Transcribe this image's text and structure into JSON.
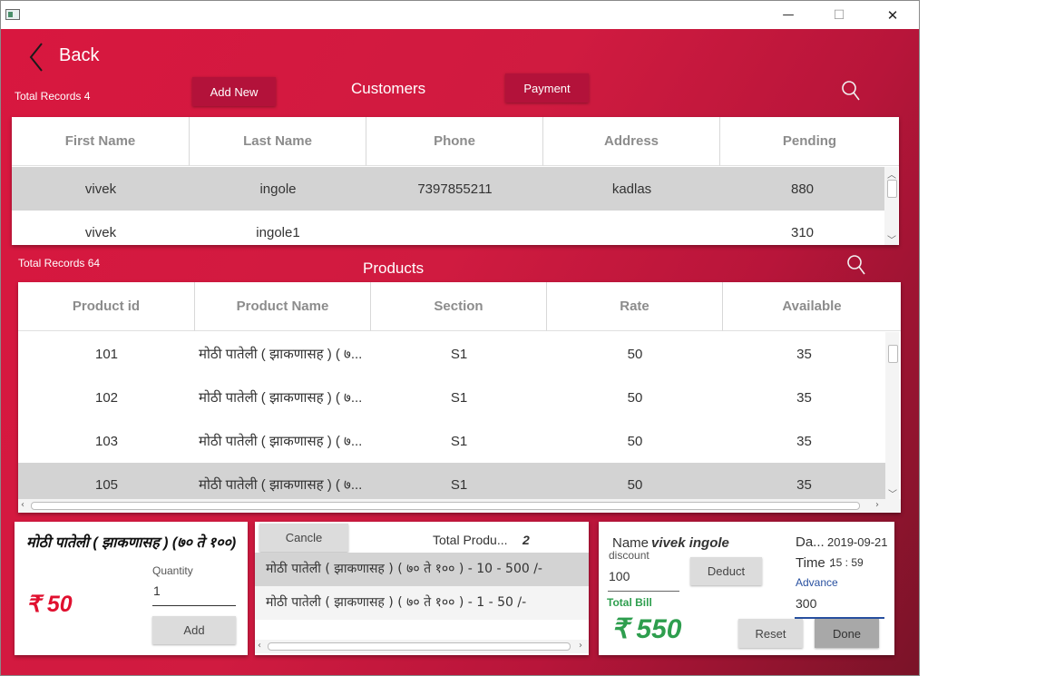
{
  "window": {
    "minimize": "—",
    "maximize": "☐",
    "close": "✕"
  },
  "header": {
    "back_label": "Back"
  },
  "customers": {
    "total_records": "Total Records 4",
    "add_new_label": "Add New",
    "title": "Customers",
    "payment_label": "Payment",
    "columns": [
      "First Name",
      "Last Name",
      "Phone",
      "Address",
      "Pending"
    ],
    "rows": [
      [
        "vivek",
        "ingole",
        "7397855211",
        "kadlas",
        "880"
      ],
      [
        "vivek",
        "ingole1",
        "",
        "",
        "310"
      ]
    ]
  },
  "products": {
    "total_records": "Total Records 64",
    "title": "Products",
    "columns": [
      "Product id",
      "Product Name",
      "Section",
      "Rate",
      "Available"
    ],
    "rows": [
      [
        "101",
        "मोठी पातेली ( झाकणासह ) ( ७...",
        "S1",
        "50",
        "35"
      ],
      [
        "102",
        "मोठी पातेली ( झाकणासह ) ( ७...",
        "S1",
        "50",
        "35"
      ],
      [
        "103",
        "मोठी पातेली ( झाकणासह ) ( ७...",
        "S1",
        "50",
        "35"
      ],
      [
        "105",
        "मोठी पातेली ( झाकणासह ) ( ७...",
        "S1",
        "50",
        "35"
      ]
    ]
  },
  "selected_product": {
    "name": "मोठी पातेली ( झाकणासह ) (७० ते १००)",
    "quantity_label": "Quantity",
    "quantity_value": "1",
    "price": "₹ 50",
    "add_label": "Add"
  },
  "cart": {
    "cancel_label": "Cancle",
    "total_products_label": "Total Produ...",
    "total_products_value": "2",
    "items": [
      "मोठी पातेली ( झाकणासह ) ( ७० ते १०० )   -   10   -    500 /-",
      "मोठी पातेली ( झाकणासह ) ( ७० ते १०० )   -   1   -    50 /-"
    ]
  },
  "bill": {
    "name_label": "Name",
    "name_value": "vivek ingole",
    "date_label": "Da...",
    "date_value": "2019-09-21",
    "discount_label": "discount",
    "discount_value": "100",
    "deduct_label": "Deduct",
    "time_label": "Time :",
    "time_value": "15 : 59",
    "advance_label": "Advance",
    "advance_value": "300",
    "total_bill_label": "Total Bill",
    "total_value": "₹ 550",
    "reset_label": "Reset",
    "done_label": "Done"
  },
  "colors": {
    "accent": "#d8173f",
    "button": "#b3123a",
    "green": "#2e9e4e"
  }
}
